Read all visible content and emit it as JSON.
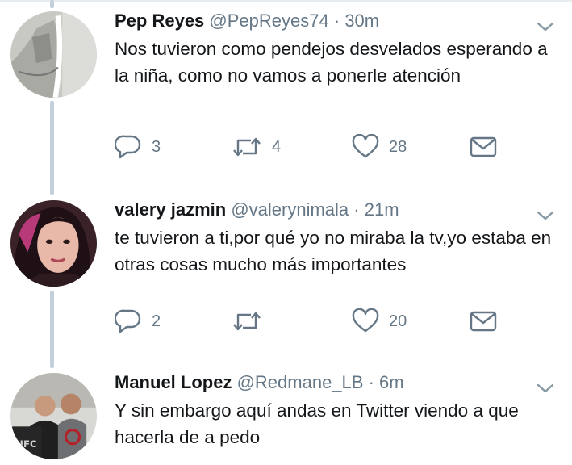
{
  "tweets": [
    {
      "name": "Pep Reyes",
      "handle": "@PepReyes74",
      "separator": "·",
      "time": "30m",
      "text": "Nos tuvieron como pendejos desvelados esperando a la niña, como no vamos a ponerle atención",
      "actions": {
        "replies": "3",
        "retweets": "4",
        "likes": "28"
      }
    },
    {
      "name": "valery jazmin",
      "handle": "@valerynimala",
      "separator": "·",
      "time": "21m",
      "text": "te tuvieron a ti,por qué yo no miraba la tv,yo estaba en otras cosas mucho más importantes",
      "actions": {
        "replies": "2",
        "retweets": "",
        "likes": "20"
      }
    },
    {
      "name": "Manuel Lopez",
      "handle": "@Redmane_LB",
      "separator": "·",
      "time": "6m",
      "text": "Y sin embargo aquí andas en Twitter viendo a que hacerla de a pedo"
    }
  ],
  "icons": {
    "reply": "speech-bubble",
    "retweet": "loop-arrows",
    "like": "heart-outline",
    "message": "envelope",
    "menu": "chevron-down"
  },
  "colors": {
    "text": "#14171a",
    "secondary": "#657786",
    "thread_line": "#c4d0d9"
  }
}
